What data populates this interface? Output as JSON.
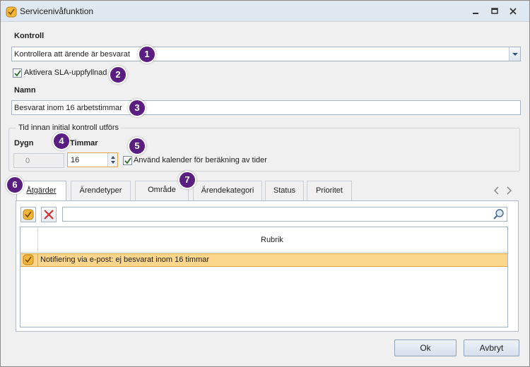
{
  "window": {
    "title": "Servicenivåfunktion"
  },
  "kontroll": {
    "label": "Kontroll",
    "value": "Kontrollera att ärende är besvarat"
  },
  "sla": {
    "label": "Aktivera SLA-uppfyllnad",
    "checked": true
  },
  "namn": {
    "label": "Namn",
    "value": "Besvarat inom 16 arbetstimmar"
  },
  "group": {
    "legend": "Tid innan initial kontroll utförs",
    "dygn_label": "Dygn",
    "dygn_value": "0",
    "timmar_label": "Timmar",
    "timmar_value": "16",
    "calendar_label": "Använd kalender för beräkning av tider",
    "calendar_checked": true
  },
  "tabs": [
    {
      "label": "Åtgärder",
      "active": true
    },
    {
      "label": "Ärendetyper"
    },
    {
      "label": "Område"
    },
    {
      "label": "Ärendekategori"
    },
    {
      "label": "Status"
    },
    {
      "label": "Prioritet"
    }
  ],
  "grid": {
    "column_header": "Rubrik",
    "rows": [
      {
        "text": "Notifiering via e-post: ej besvarat inom 16 timmar"
      }
    ]
  },
  "buttons": {
    "ok": "Ok",
    "cancel": "Avbryt"
  },
  "callouts": [
    "1",
    "2",
    "3",
    "4",
    "5",
    "6",
    "7"
  ],
  "colors": {
    "callout": "#5a1e80",
    "selected_row": "#fbd78d",
    "titlebar": "#dfe7f0"
  }
}
